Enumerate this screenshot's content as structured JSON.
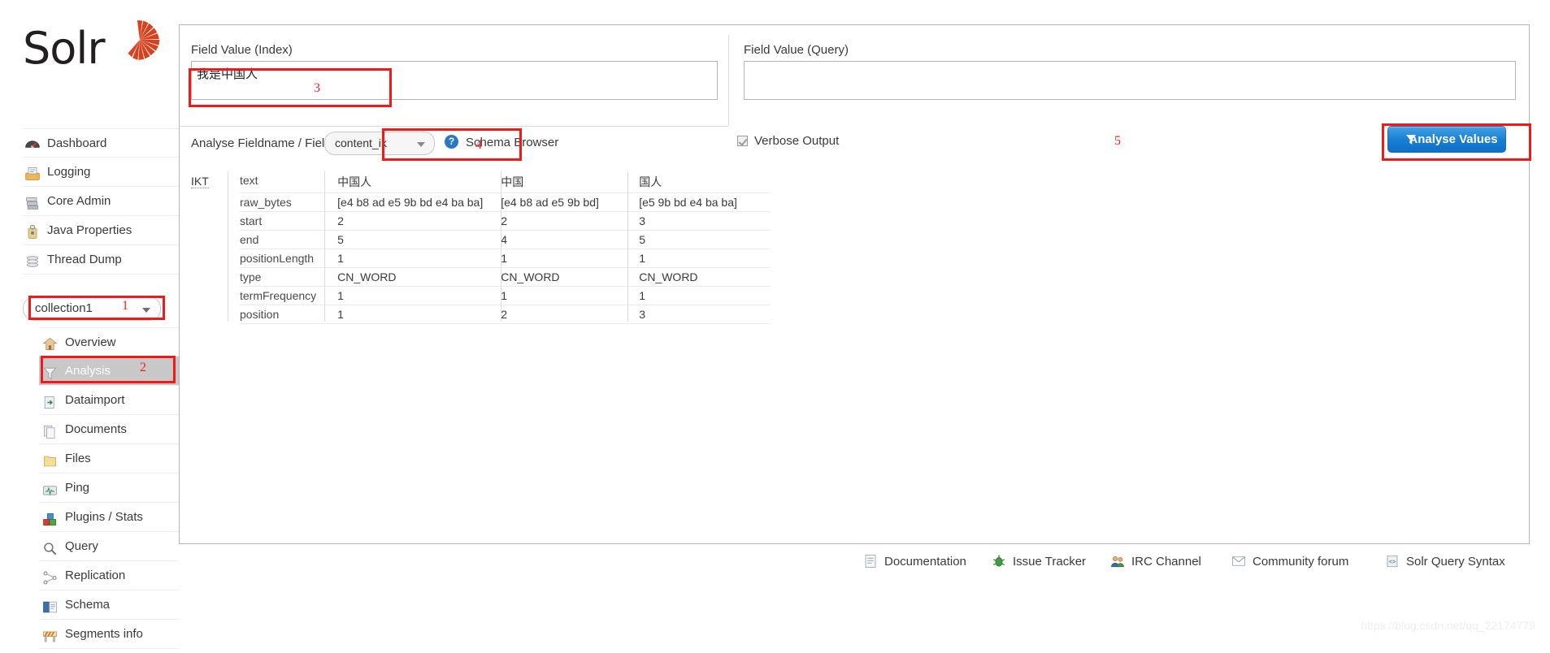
{
  "brand": {
    "name": "Solr",
    "logo_icon": "solr-sunburst-icon"
  },
  "sidebar": {
    "global_items": [
      {
        "label": "Dashboard",
        "icon": "dashboard-icon"
      },
      {
        "label": "Logging",
        "icon": "logging-icon"
      },
      {
        "label": "Core Admin",
        "icon": "core-admin-icon"
      },
      {
        "label": "Java Properties",
        "icon": "java-properties-icon"
      },
      {
        "label": "Thread Dump",
        "icon": "thread-dump-icon"
      }
    ],
    "core_selector": {
      "value": "collection1",
      "icon": "chevron-down-icon"
    },
    "core_items": [
      {
        "label": "Overview",
        "icon": "home-icon",
        "active": false
      },
      {
        "label": "Analysis",
        "icon": "funnel-icon",
        "active": true
      },
      {
        "label": "Dataimport",
        "icon": "dataimport-icon",
        "active": false
      },
      {
        "label": "Documents",
        "icon": "documents-icon",
        "active": false
      },
      {
        "label": "Files",
        "icon": "folder-icon",
        "active": false
      },
      {
        "label": "Ping",
        "icon": "ping-icon",
        "active": false
      },
      {
        "label": "Plugins / Stats",
        "icon": "plugins-icon",
        "active": false
      },
      {
        "label": "Query",
        "icon": "magnifier-icon",
        "active": false
      },
      {
        "label": "Replication",
        "icon": "replication-icon",
        "active": false
      },
      {
        "label": "Schema",
        "icon": "book-icon",
        "active": false
      },
      {
        "label": "Segments info",
        "icon": "barrier-icon",
        "active": false
      }
    ]
  },
  "analysis": {
    "index_label": "Field Value (Index)",
    "index_value": "我是中国人",
    "query_label": "Field Value (Query)",
    "query_value": "",
    "fieldtype_label": "Analyse Fieldname / FieldType:",
    "fieldtype_value": "content_ik",
    "help_glyph": "?",
    "schema_browser_label": "Schema Browser",
    "verbose_label": "Verbose Output",
    "verbose_checked": true,
    "analyse_button_label": "Analyse Values",
    "analyse_button_icon": "funnel-icon"
  },
  "result": {
    "analyzer_label": "IKT",
    "rows": [
      "text",
      "raw_bytes",
      "start",
      "end",
      "positionLength",
      "type",
      "termFrequency",
      "position"
    ],
    "tokens": [
      {
        "text": "中国人",
        "raw_bytes": "[e4 b8 ad e5 9b bd e4 ba ba]",
        "start": "2",
        "end": "5",
        "positionLength": "1",
        "type": "CN_WORD",
        "termFrequency": "1",
        "position": "1"
      },
      {
        "text": "中国",
        "raw_bytes": "[e4 b8 ad e5 9b bd]",
        "start": "2",
        "end": "4",
        "positionLength": "1",
        "type": "CN_WORD",
        "termFrequency": "1",
        "position": "2"
      },
      {
        "text": "国人",
        "raw_bytes": "[e5 9b bd e4 ba ba]",
        "start": "3",
        "end": "5",
        "positionLength": "1",
        "type": "CN_WORD",
        "termFrequency": "1",
        "position": "3"
      }
    ]
  },
  "footer": {
    "links": [
      {
        "label": "Documentation",
        "icon": "document-icon"
      },
      {
        "label": "Issue Tracker",
        "icon": "bug-icon"
      },
      {
        "label": "IRC Channel",
        "icon": "people-icon"
      },
      {
        "label": "Community forum",
        "icon": "envelope-icon"
      },
      {
        "label": "Solr Query Syntax",
        "icon": "code-icon"
      }
    ]
  },
  "watermark": "https://blog.csdn.net/qq_22174779",
  "annotations": {
    "numbers": [
      "1",
      "2",
      "3",
      "4",
      "5"
    ],
    "color": "#ee2222"
  },
  "colors": {
    "accent_blue": "#1a7fd4",
    "annotation_red": "#ee1b1b",
    "active_nav_bg": "#c8c8c8",
    "logo_red": "#d9411e"
  }
}
